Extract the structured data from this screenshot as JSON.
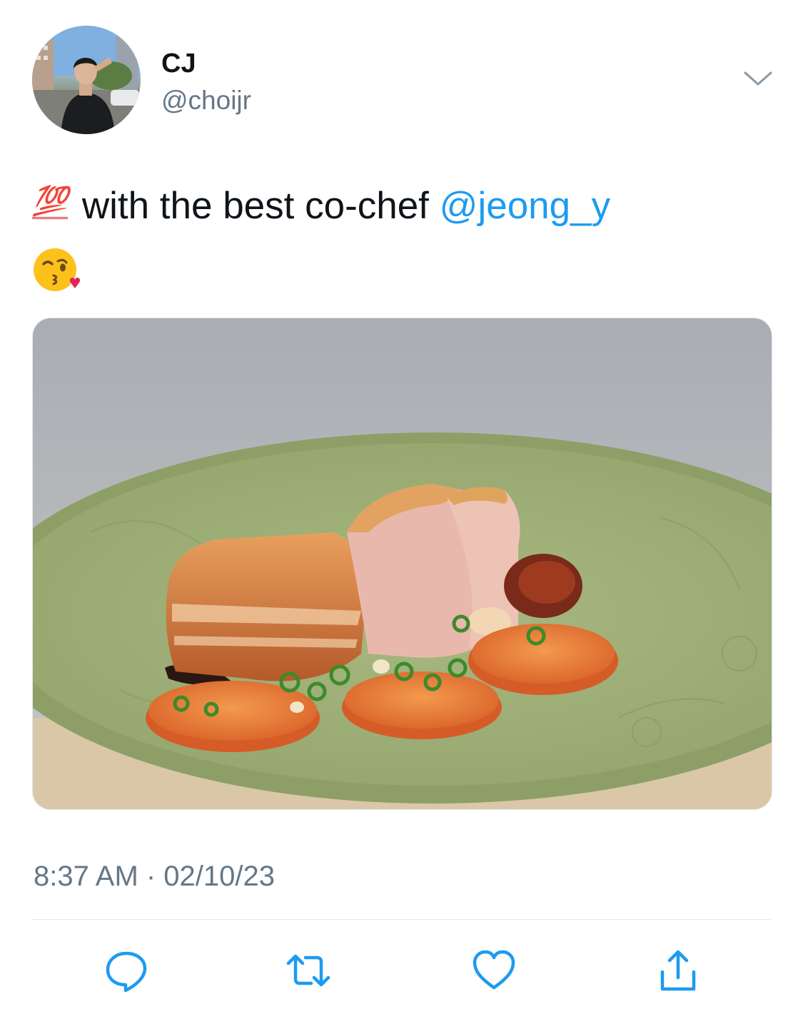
{
  "tweet": {
    "author": {
      "display_name": "CJ",
      "handle": "@choijr"
    },
    "text": {
      "emoji_100": "💯",
      "body": "with the best co-chef",
      "mention": "@jeong_y",
      "emoji_kiss": "😘"
    },
    "timestamp": "8:37 AM · 02/10/23"
  },
  "icons": {
    "menu": "chevron-down-icon",
    "actions": [
      "reply-icon",
      "retweet-icon",
      "like-icon",
      "share-icon"
    ]
  },
  "colors": {
    "link": "#1d9bf0",
    "secondary_text": "#657786",
    "icon": "#1d9bf0"
  }
}
